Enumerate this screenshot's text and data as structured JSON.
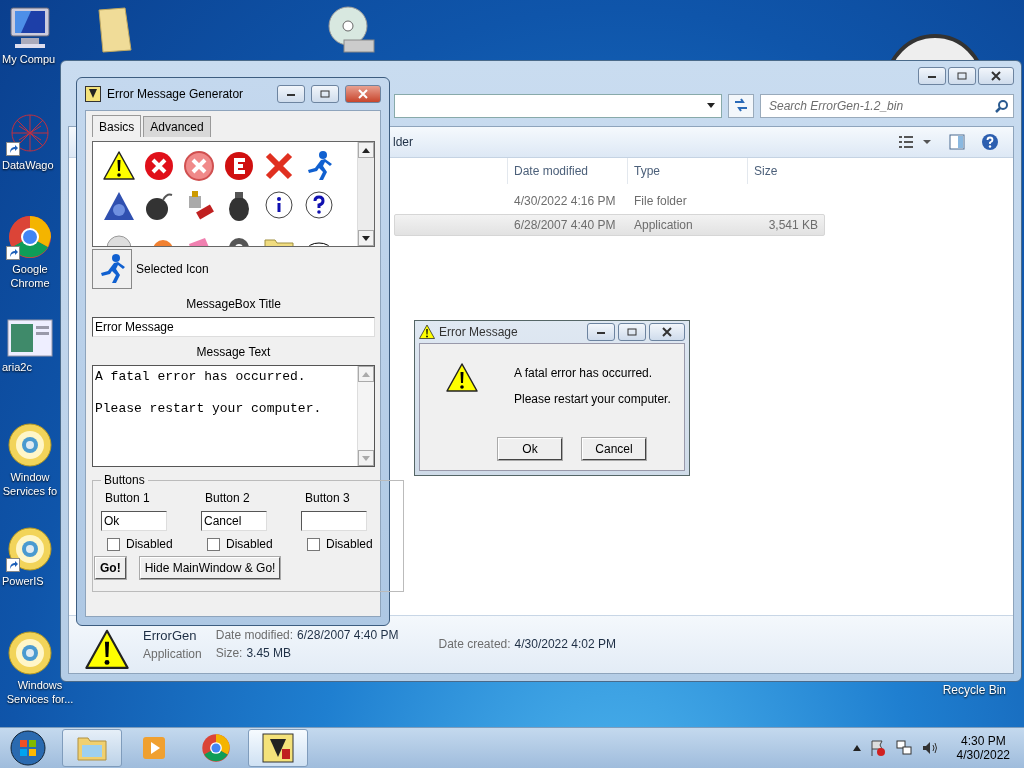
{
  "desktop": {
    "icons": [
      {
        "label": "My Compu",
        "kind": "computer",
        "shortcut": false
      },
      {
        "label": "DataWago",
        "kind": "network",
        "shortcut": true
      },
      {
        "label": "Google Chrome",
        "kind": "chrome",
        "shortcut": true
      },
      {
        "label": "aria2c",
        "kind": "app",
        "shortcut": false
      },
      {
        "label": "Window Services fo",
        "kind": "disc",
        "shortcut": false
      },
      {
        "label": "PowerIS",
        "kind": "disc",
        "shortcut": true
      },
      {
        "label": "Windows Services for...",
        "kind": "disc",
        "shortcut": false
      }
    ],
    "recycle_bin": {
      "label": "Recycle Bin"
    }
  },
  "explorer": {
    "search": {
      "placeholder": "Search ErrorGen-1.2_bin"
    },
    "toolbar": {
      "label": "lder"
    },
    "columns": [
      "Date modified",
      "Type",
      "Size"
    ],
    "rows": [
      {
        "date": "4/30/2022 4:16 PM",
        "type": "File folder",
        "selected": false
      },
      {
        "date": "6/28/2007 4:40 PM",
        "type": "Application",
        "size": "3,541 KB",
        "selected": true
      }
    ],
    "details": {
      "name": "ErrorGen",
      "type": "Application",
      "fields": [
        {
          "label": "Date modified:",
          "value": "6/28/2007 4:40 PM"
        },
        {
          "label": "Size:",
          "value": "3.45 MB"
        },
        {
          "label": "Date created:",
          "value": "4/30/2022 4:02 PM"
        }
      ]
    }
  },
  "generator": {
    "title": "Error Message Generator",
    "tabs": [
      {
        "label": "Basics",
        "selected": true
      },
      {
        "label": "Advanced",
        "selected": false
      }
    ],
    "selected_icon_label": "Selected Icon",
    "title_label": "MessageBox Title",
    "title_value": "Error Message",
    "text_label": "Message Text",
    "text_value": "A fatal error has occurred.\n\nPlease restart your computer.",
    "buttons_group": {
      "legend": "Buttons",
      "buttons": [
        {
          "label": "Button 1",
          "value": "Ok",
          "disabled_label": "Disabled",
          "checked": false
        },
        {
          "label": "Button 2",
          "value": "Cancel",
          "disabled_label": "Disabled",
          "checked": false
        },
        {
          "label": "Button 3",
          "disabled_label": "Disabled",
          "checked": false
        }
      ]
    },
    "actions": [
      {
        "label": "Go!",
        "kind": "primary"
      },
      {
        "label": "Hide MainWindow & Go!",
        "kind": "normal"
      }
    ]
  },
  "error_dialog": {
    "title": "Error Message",
    "lines": [
      "A fatal error has occurred.",
      "Please restart your computer."
    ],
    "buttons": [
      "Ok",
      "Cancel"
    ]
  },
  "taskbar": {
    "apps": [
      {
        "kind": "explorer",
        "open": true,
        "selected": false
      },
      {
        "kind": "media",
        "open": false,
        "selected": false
      },
      {
        "kind": "chrome",
        "open": false,
        "selected": false
      },
      {
        "kind": "errorgen",
        "open": true,
        "selected": true
      }
    ],
    "time": "4:30 PM",
    "date": "4/30/2022"
  }
}
